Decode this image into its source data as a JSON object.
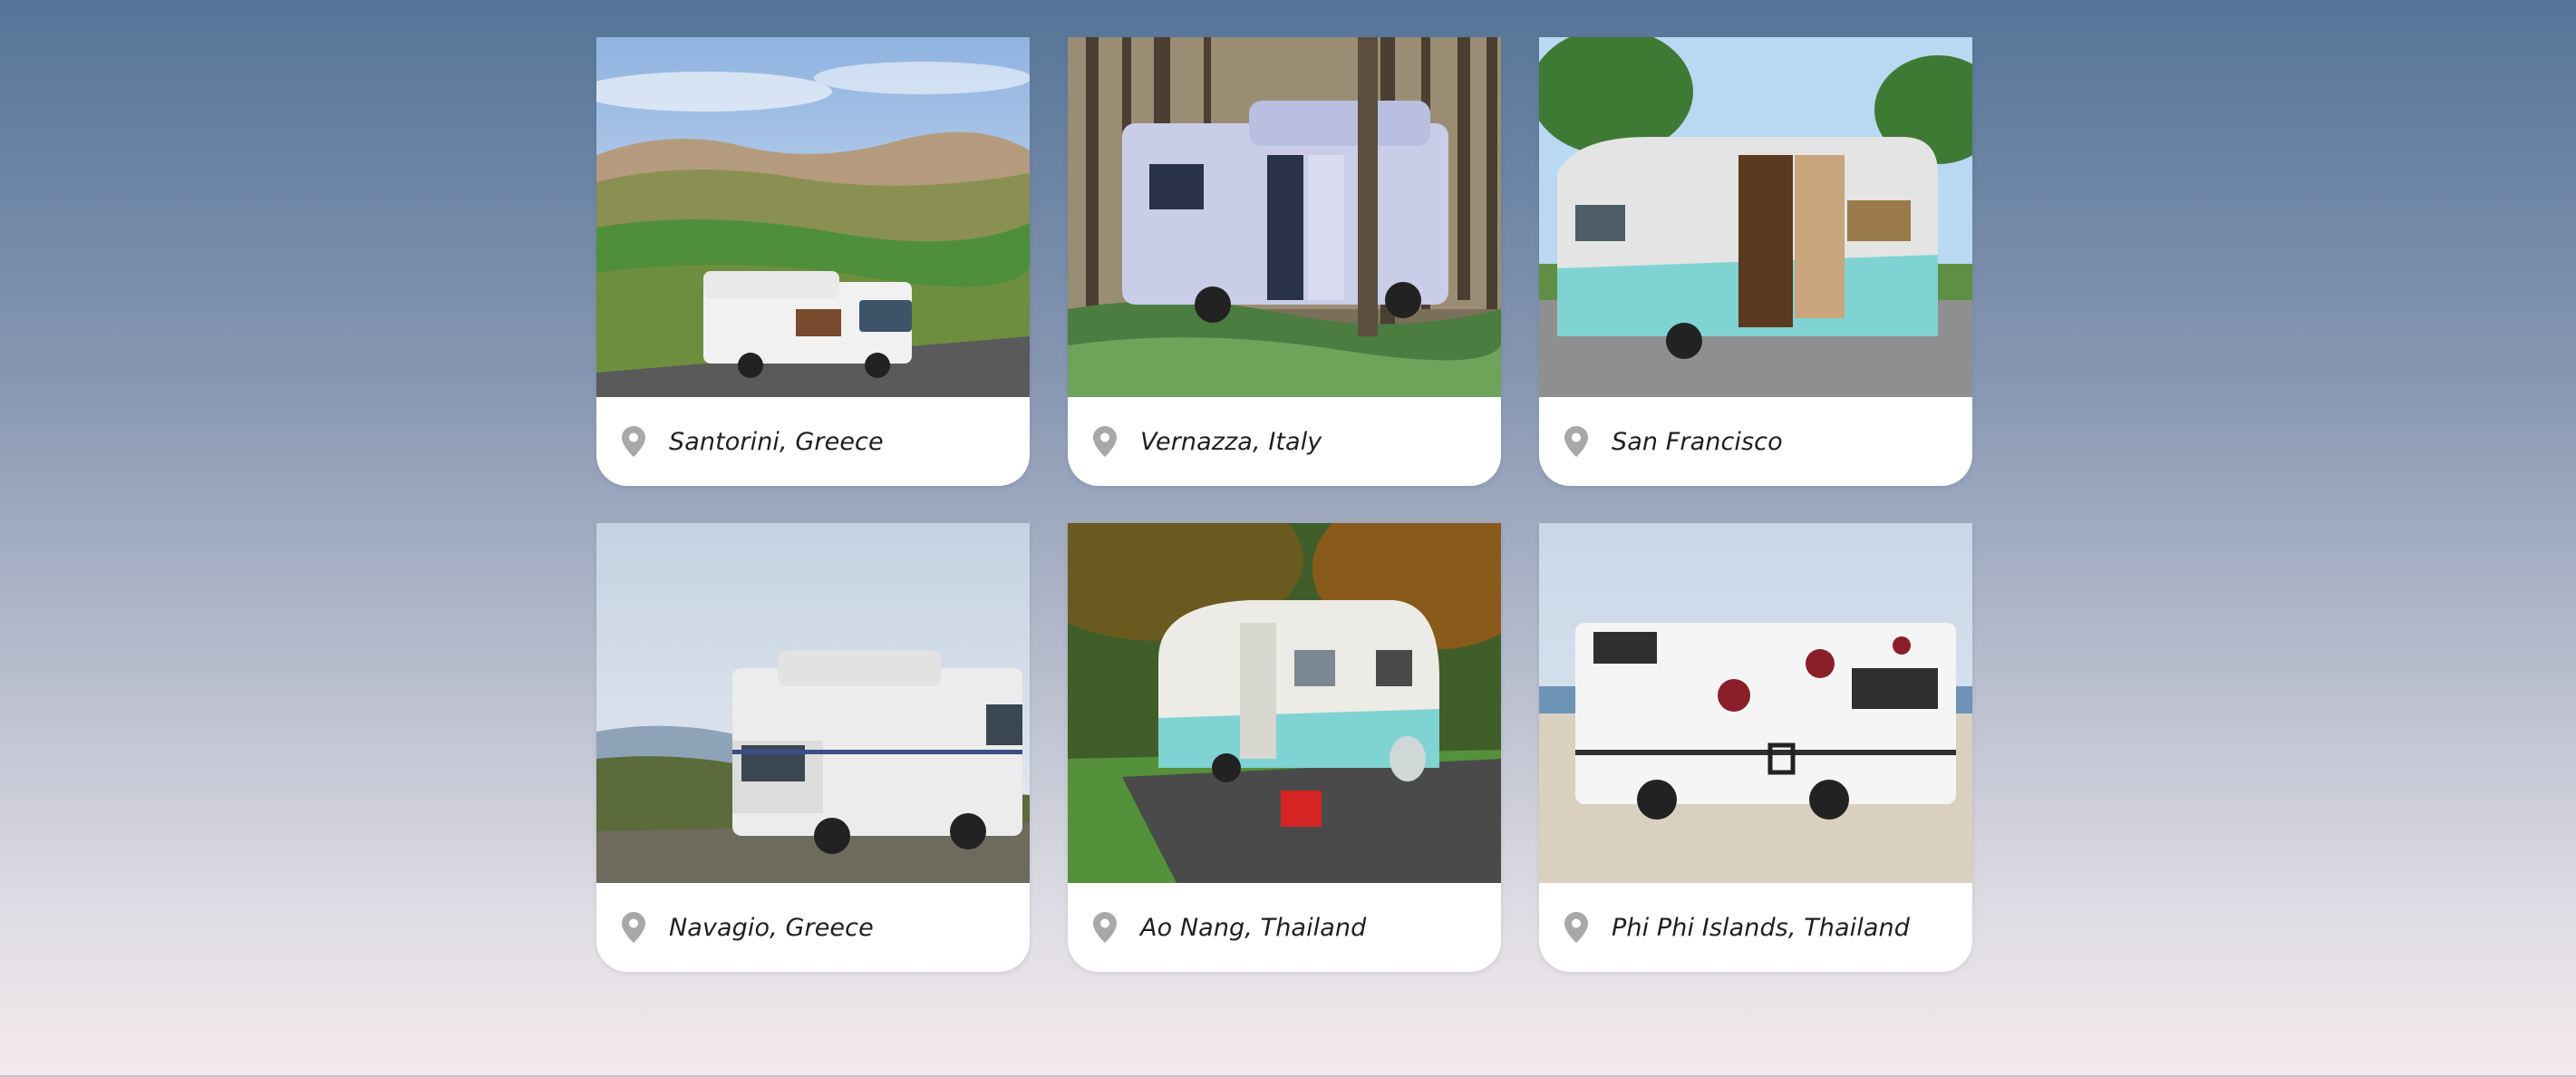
{
  "destinations": [
    {
      "location": "Santorini, Greece",
      "pin_icon": "map-marker-icon",
      "photo": "motorhome parked on a hillside road above green valleys"
    },
    {
      "location": "Vernazza, Italy",
      "pin_icon": "map-marker-icon",
      "photo": "motorhome among tall trees in a forest"
    },
    {
      "location": "San Francisco",
      "pin_icon": "map-marker-icon",
      "photo": "vintage teal and white travel trailer with open door"
    },
    {
      "location": "Navagio, Greece",
      "pin_icon": "map-marker-icon",
      "photo": "white motorhome on a grassy cliff under a cloudy sky"
    },
    {
      "location": "Ao Nang, Thailand",
      "pin_icon": "map-marker-icon",
      "photo": "teal vintage trailer at a campsite with red cooler"
    },
    {
      "location": "Phi Phi Islands, Thailand",
      "pin_icon": "map-marker-icon",
      "photo": "white camper van with flower decals by the sea"
    }
  ],
  "colors": {
    "background_top": "#557598",
    "background_bottom": "#f3eaed",
    "card": "#ffffff",
    "pin": "#a8a8a8"
  }
}
